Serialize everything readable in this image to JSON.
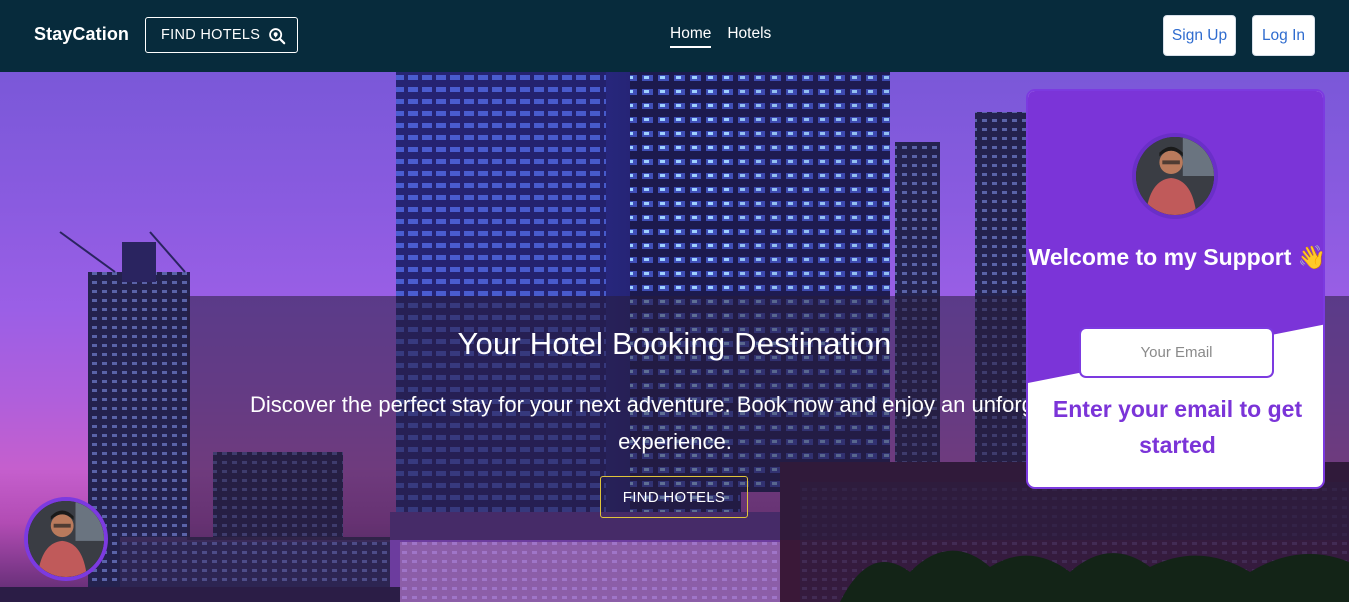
{
  "navbar": {
    "brand": "StayCation",
    "find_hotels_label": "FIND HOTELS",
    "links": [
      {
        "label": "Home",
        "active": true
      },
      {
        "label": "Hotels",
        "active": false
      }
    ],
    "signup_label": "Sign Up",
    "login_label": "Log In"
  },
  "hero": {
    "title": "Your Hotel Booking Destination",
    "subtitle": "Discover the perfect stay for your next adventure. Book now and enjoy an unforgettable experience.",
    "cta_label": "FIND HOTELS"
  },
  "support_widget": {
    "title": "Welcome to my Support 👋",
    "email_placeholder": "Your Email",
    "cta": "Enter your email to get started"
  },
  "colors": {
    "navbar_bg": "#072b3c",
    "accent_purple": "#7c3ae0",
    "link_blue": "#2f6ccf",
    "hero_button_border": "#e0c43a"
  },
  "icons": {
    "find_hotels": "search-location-icon"
  }
}
